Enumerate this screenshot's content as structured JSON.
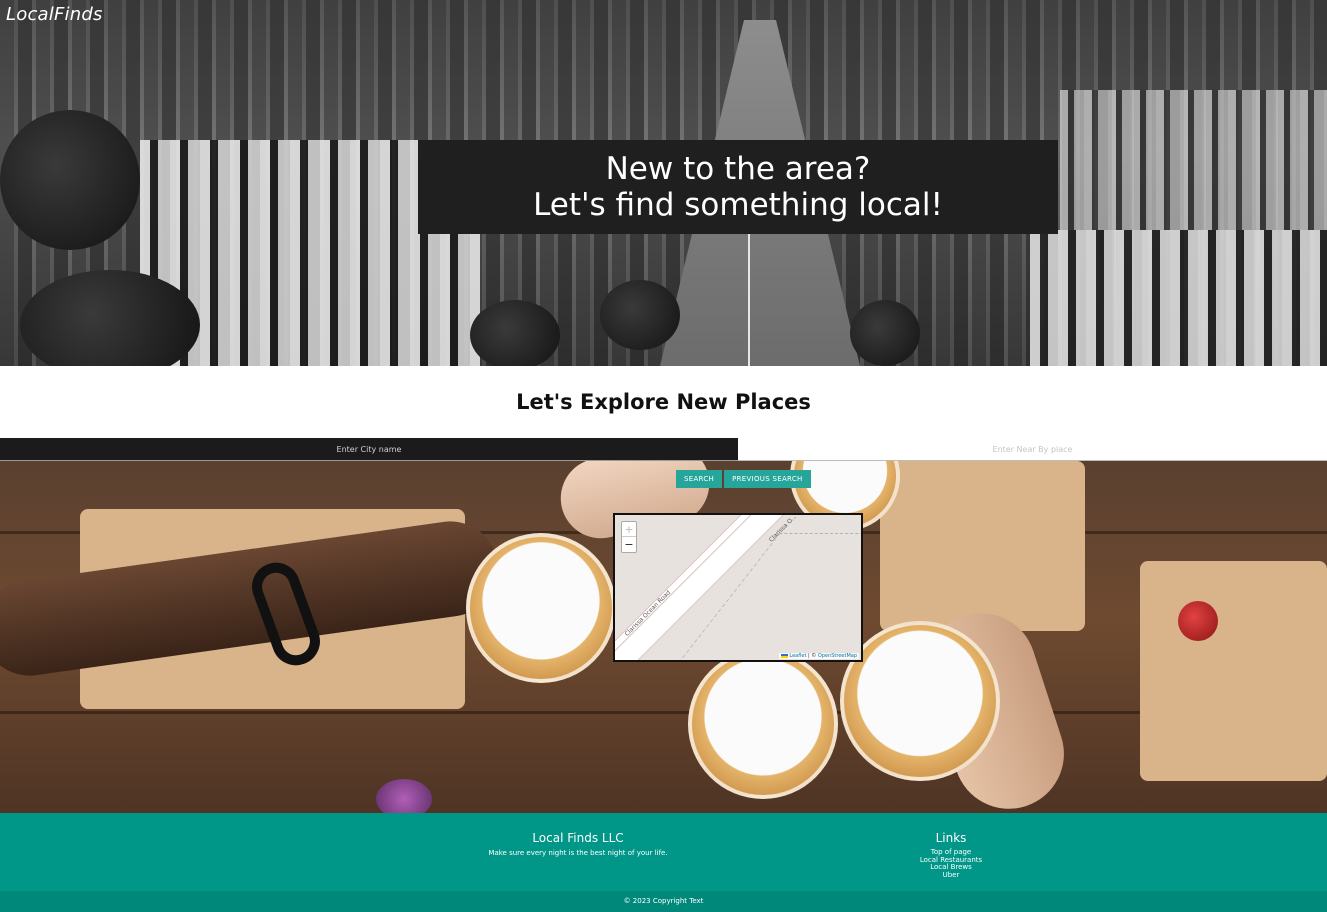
{
  "brand": {
    "name": "LocalFinds"
  },
  "hero": {
    "line1": "New to the area?",
    "line2": "Let's find something local!"
  },
  "explore": {
    "title": "Let's Explore New Places"
  },
  "search": {
    "city_placeholder": "Enter City name",
    "near_placeholder": "Enter Near By place",
    "search_label": "SEARCH",
    "previous_label": "PREVIOUS SEARCH"
  },
  "map": {
    "zoom_in": "+",
    "zoom_out": "−",
    "street_1": "Clarissa Ocean Road",
    "street_2": "Clarissa O...",
    "attribution_leaflet": "Leaflet",
    "attribution_sep": " | © ",
    "attribution_osm": "OpenStreetMap"
  },
  "footer": {
    "company_title": "Local Finds LLC",
    "company_tagline": "Make sure every night is the best night of your life.",
    "links_title": "Links",
    "links": [
      "Top of page",
      "Local Restaurants",
      "Local Brews",
      "Uber"
    ],
    "copyright": "© 2023 Copyright Text"
  },
  "colors": {
    "accent": "#26a69a",
    "footer": "#009688",
    "footer_bottom": "#00897b",
    "hero_box": "#1f1f1f"
  }
}
